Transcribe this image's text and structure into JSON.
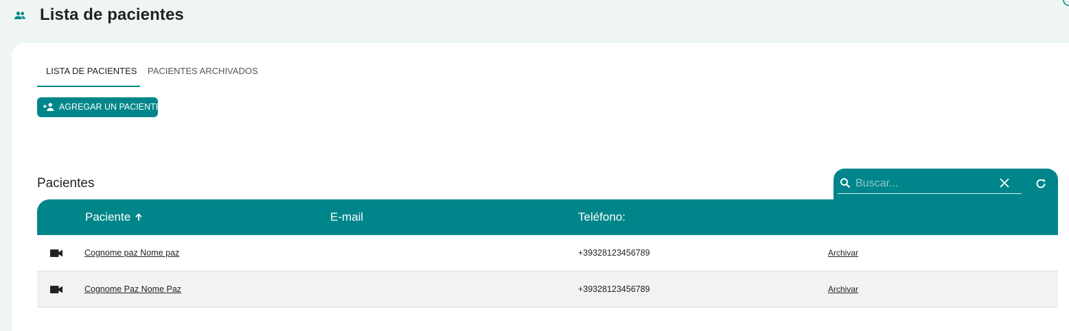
{
  "header": {
    "title": "Lista de pacientes",
    "icon": "people-icon"
  },
  "tabs": [
    {
      "label": "LISTA DE PACIENTES",
      "active": true
    },
    {
      "label": "PACIENTES ARCHIVADOS",
      "active": false
    }
  ],
  "add_button": {
    "label": "AGREGAR UN PACIENTE",
    "icon": "person-add-icon"
  },
  "section_title": "Pacientes",
  "search": {
    "placeholder": "Buscar...",
    "value": ""
  },
  "table": {
    "columns": [
      "Paciente",
      "E-mail",
      "Teléfono:"
    ],
    "sort": {
      "column": "Paciente",
      "direction": "ascending"
    },
    "rows": [
      {
        "name": "Cognome paz Nome paz",
        "email": "",
        "phone": "+39328123456789",
        "action": "Archivar"
      },
      {
        "name": "Cognome Paz Nome Paz",
        "email": "",
        "phone": "+39328123456789",
        "action": "Archivar"
      }
    ]
  },
  "colors": {
    "accent": "#00868a",
    "background": "#eef5f2",
    "card": "#ffffff",
    "row_alt": "#f2f2f2"
  }
}
